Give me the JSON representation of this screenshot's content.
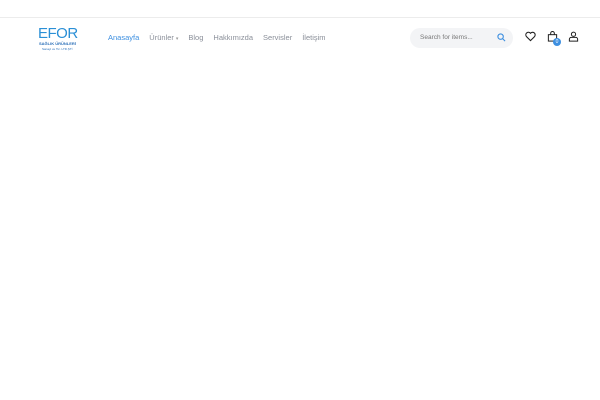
{
  "logo": {
    "name": "EFOR",
    "subtitle": "SAĞLIK ÜRÜNLERİ",
    "tagline": "Sanayi ve Tic. LTD.ŞTİ"
  },
  "nav": {
    "items": [
      {
        "label": "Anasayfa"
      },
      {
        "label": "Ürünler"
      },
      {
        "label": "Blog"
      },
      {
        "label": "Hakkımızda"
      },
      {
        "label": "Servisler"
      },
      {
        "label": "İletişim"
      }
    ]
  },
  "search": {
    "placeholder": "Search for items..."
  },
  "cart": {
    "count": "0"
  },
  "colors": {
    "accent": "#3d8fe0"
  }
}
